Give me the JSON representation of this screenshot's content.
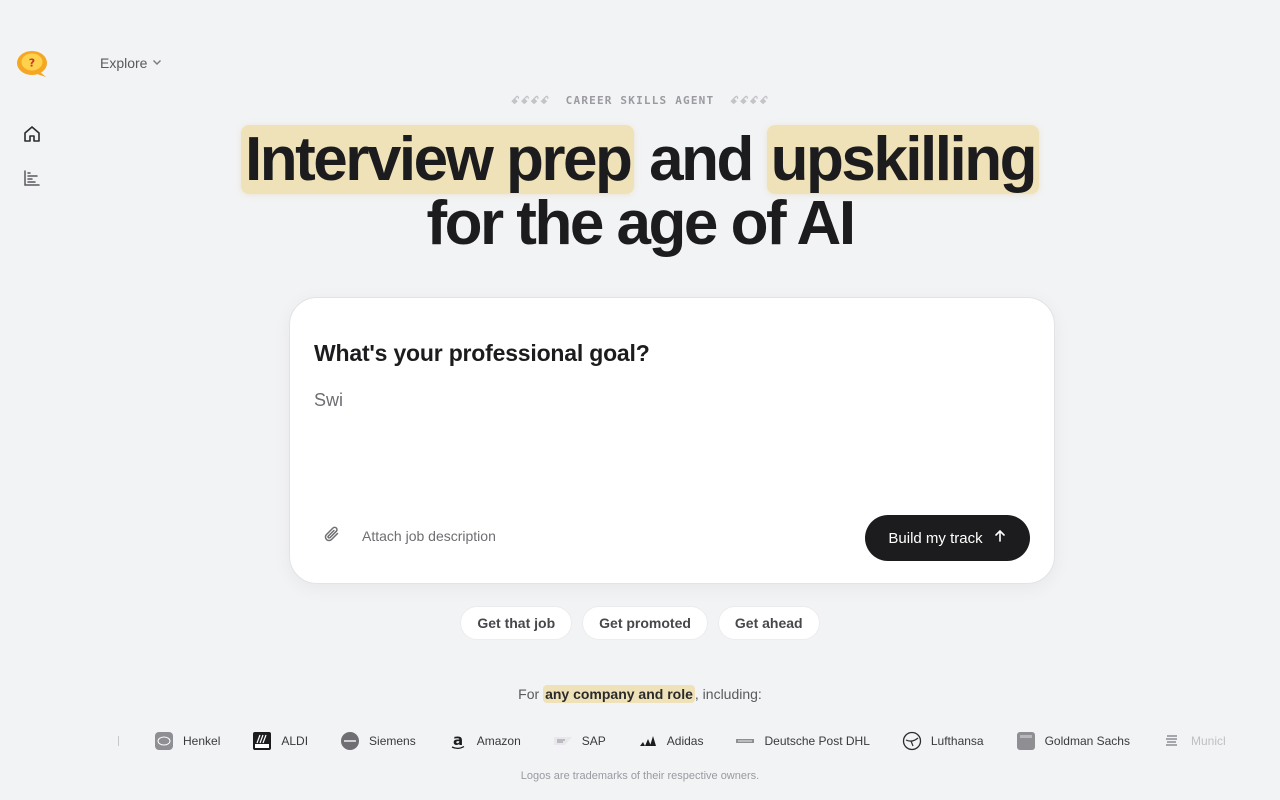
{
  "nav": {
    "logo_glyph": "?",
    "explore_label": "Explore",
    "items": [
      {
        "icon": "home-icon"
      },
      {
        "icon": "bar-chart-icon"
      }
    ]
  },
  "hero": {
    "eyebrow": "CAREER SKILLS AGENT",
    "eyebrow_deco": "ꗃꗃꗃꗃ",
    "headline_hl1": "Interview prep",
    "headline_mid": " and ",
    "headline_hl2": "upskilling",
    "headline_line2": "for the age of AI"
  },
  "card": {
    "title": "What's your professional goal?",
    "input_value": "Swi",
    "attach_label": "Attach job description",
    "build_label": "Build my track"
  },
  "chips": [
    "Get that job",
    "Get promoted",
    "Get ahead"
  ],
  "companies": {
    "prefix": "For ",
    "highlight": "any company and role",
    "suffix": ", including:",
    "list": [
      "Henkel",
      "ALDI",
      "Siemens",
      "Amazon",
      "SAP",
      "Adidas",
      "Deutsche Post DHL",
      "Lufthansa",
      "Goldman Sachs",
      "Munich"
    ],
    "footnote": "Logos are trademarks of their respective owners."
  },
  "colors": {
    "highlight": "#efe2b8",
    "button": "#1c1c1e",
    "logo_orange": "#f5a623"
  }
}
